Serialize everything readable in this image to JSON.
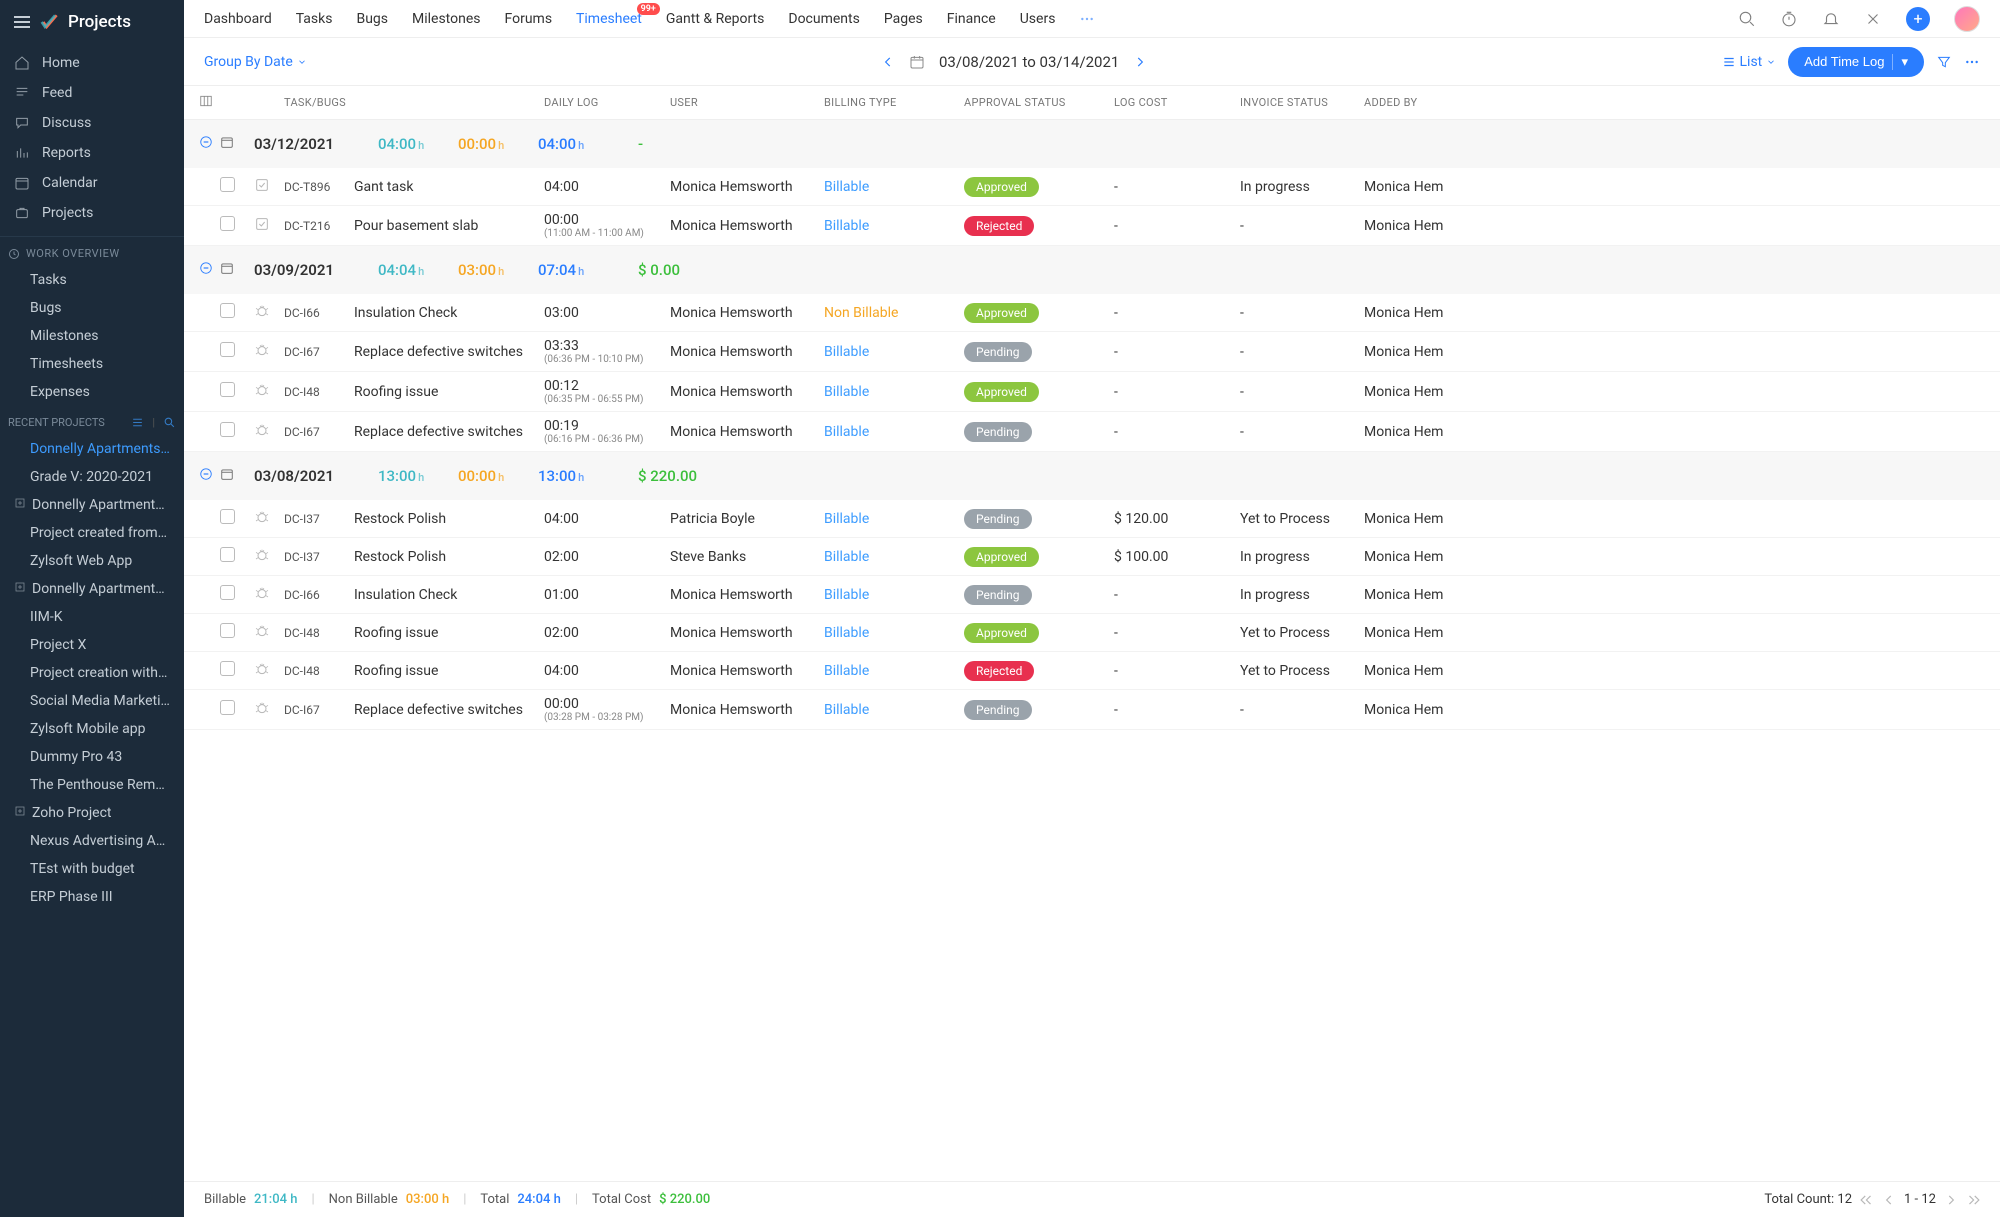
{
  "app": {
    "name": "Projects"
  },
  "sidebar": {
    "nav": [
      {
        "label": "Home",
        "icon": "home"
      },
      {
        "label": "Feed",
        "icon": "feed"
      },
      {
        "label": "Discuss",
        "icon": "discuss"
      },
      {
        "label": "Reports",
        "icon": "reports"
      },
      {
        "label": "Calendar",
        "icon": "calendar"
      },
      {
        "label": "Projects",
        "icon": "projects"
      }
    ],
    "work_overview_label": "WORK OVERVIEW",
    "work": [
      {
        "label": "Tasks"
      },
      {
        "label": "Bugs"
      },
      {
        "label": "Milestones"
      },
      {
        "label": "Timesheets"
      },
      {
        "label": "Expenses"
      }
    ],
    "recent_label": "RECENT PROJECTS",
    "recent": [
      {
        "label": "Donnelly Apartments C",
        "active": true
      },
      {
        "label": "Grade V: 2020-2021"
      },
      {
        "label": "Donnelly Apartments C",
        "indent": true
      },
      {
        "label": "Project created from CF"
      },
      {
        "label": "Zylsoft Web App"
      },
      {
        "label": "Donnelly Apartments C",
        "indent": true
      },
      {
        "label": "IIM-K"
      },
      {
        "label": "Project X"
      },
      {
        "label": "Project creation with la"
      },
      {
        "label": "Social Media Marketing"
      },
      {
        "label": "Zylsoft Mobile app"
      },
      {
        "label": "Dummy Pro 43"
      },
      {
        "label": "The Penthouse Remode"
      },
      {
        "label": "Zoho Project",
        "indent": true
      },
      {
        "label": "Nexus Advertising Agen"
      },
      {
        "label": "TEst with budget"
      },
      {
        "label": "ERP Phase III"
      }
    ]
  },
  "topnav": {
    "items": [
      "Dashboard",
      "Tasks",
      "Bugs",
      "Milestones",
      "Forums",
      "Timesheet",
      "Gantt & Reports",
      "Documents",
      "Pages",
      "Finance",
      "Users"
    ],
    "active": "Timesheet",
    "badge": "99+"
  },
  "toolbar": {
    "group_by": "Group By Date",
    "date_range": "03/08/2021 to 03/14/2021",
    "view": "List",
    "add_log": "Add Time Log"
  },
  "columns": [
    "TASK/BUGS",
    "DAILY LOG",
    "USER",
    "BILLING TYPE",
    "APPROVAL STATUS",
    "LOG COST",
    "INVOICE STATUS",
    "ADDED BY"
  ],
  "groups": [
    {
      "date": "03/12/2021",
      "bill": "04:00",
      "nonbill": "00:00",
      "total": "04:00",
      "amount": "-",
      "rows": [
        {
          "id": "DC-T896",
          "task": "Gant task",
          "type": "task",
          "log": "04:00",
          "sub": "",
          "user": "Monica Hemsworth",
          "billing": "Billable",
          "approval": "Approved",
          "cost": "-",
          "invoice": "In progress",
          "added": "Monica Hem"
        },
        {
          "id": "DC-T216",
          "task": "Pour basement slab",
          "type": "task",
          "log": "00:00",
          "sub": "(11:00 AM - 11:00 AM)",
          "user": "Monica Hemsworth",
          "billing": "Billable",
          "approval": "Rejected",
          "cost": "-",
          "invoice": "-",
          "added": "Monica Hem"
        }
      ]
    },
    {
      "date": "03/09/2021",
      "bill": "04:04",
      "nonbill": "03:00",
      "total": "07:04",
      "amount": "$ 0.00",
      "rows": [
        {
          "id": "DC-I66",
          "task": "Insulation Check",
          "type": "bug",
          "log": "03:00",
          "sub": "",
          "user": "Monica Hemsworth",
          "billing": "Non Billable",
          "approval": "Approved",
          "cost": "-",
          "invoice": "-",
          "added": "Monica Hem"
        },
        {
          "id": "DC-I67",
          "task": "Replace defective switches",
          "type": "bug",
          "log": "03:33",
          "sub": "(06:36 PM - 10:10 PM)",
          "user": "Monica Hemsworth",
          "billing": "Billable",
          "approval": "Pending",
          "cost": "-",
          "invoice": "-",
          "added": "Monica Hem"
        },
        {
          "id": "DC-I48",
          "task": "Roofing issue",
          "type": "bug",
          "log": "00:12",
          "sub": "(06:35 PM - 06:55 PM)",
          "user": "Monica Hemsworth",
          "billing": "Billable",
          "approval": "Approved",
          "cost": "-",
          "invoice": "-",
          "added": "Monica Hem"
        },
        {
          "id": "DC-I67",
          "task": "Replace defective switches",
          "type": "bug",
          "log": "00:19",
          "sub": "(06:16 PM - 06:36 PM)",
          "user": "Monica Hemsworth",
          "billing": "Billable",
          "approval": "Pending",
          "cost": "-",
          "invoice": "-",
          "added": "Monica Hem"
        }
      ]
    },
    {
      "date": "03/08/2021",
      "bill": "13:00",
      "nonbill": "00:00",
      "total": "13:00",
      "amount": "$ 220.00",
      "rows": [
        {
          "id": "DC-I37",
          "task": "Restock Polish",
          "type": "bug",
          "log": "04:00",
          "sub": "",
          "user": "Patricia Boyle",
          "billing": "Billable",
          "approval": "Pending",
          "cost": "$ 120.00",
          "invoice": "Yet to Process",
          "added": "Monica Hem"
        },
        {
          "id": "DC-I37",
          "task": "Restock Polish",
          "type": "bug",
          "log": "02:00",
          "sub": "",
          "user": "Steve Banks",
          "billing": "Billable",
          "approval": "Approved",
          "cost": "$ 100.00",
          "invoice": "In progress",
          "added": "Monica Hem"
        },
        {
          "id": "DC-I66",
          "task": "Insulation Check",
          "type": "bug",
          "log": "01:00",
          "sub": "",
          "user": "Monica Hemsworth",
          "billing": "Billable",
          "approval": "Pending",
          "cost": "-",
          "invoice": "In progress",
          "added": "Monica Hem"
        },
        {
          "id": "DC-I48",
          "task": "Roofing issue",
          "type": "bug",
          "log": "02:00",
          "sub": "",
          "user": "Monica Hemsworth",
          "billing": "Billable",
          "approval": "Approved",
          "cost": "-",
          "invoice": "Yet to Process",
          "added": "Monica Hem"
        },
        {
          "id": "DC-I48",
          "task": "Roofing issue",
          "type": "bug",
          "log": "04:00",
          "sub": "",
          "user": "Monica Hemsworth",
          "billing": "Billable",
          "approval": "Rejected",
          "cost": "-",
          "invoice": "Yet to Process",
          "added": "Monica Hem"
        },
        {
          "id": "DC-I67",
          "task": "Replace defective switches",
          "type": "bug",
          "log": "00:00",
          "sub": "(03:28 PM - 03:28 PM)",
          "user": "Monica Hemsworth",
          "billing": "Billable",
          "approval": "Pending",
          "cost": "-",
          "invoice": "-",
          "added": "Monica Hem"
        }
      ]
    }
  ],
  "footer": {
    "billable_label": "Billable",
    "billable": "21:04 h",
    "nonbillable_label": "Non Billable",
    "nonbillable": "03:00 h",
    "total_label": "Total",
    "total": "24:04 h",
    "cost_label": "Total Cost",
    "cost": "$ 220.00",
    "count_label": "Total Count: 12",
    "range": "1 - 12"
  }
}
